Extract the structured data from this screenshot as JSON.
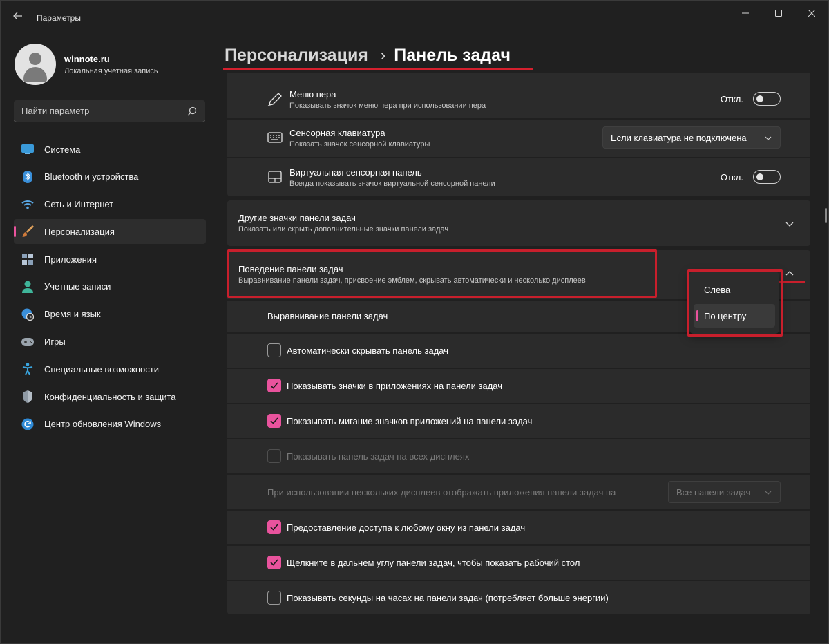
{
  "window": {
    "title": "Параметры",
    "back_icon": "arrow-left-icon",
    "controls": [
      "minimize-icon",
      "maximize-icon",
      "close-icon"
    ]
  },
  "profile": {
    "name": "winnote.ru",
    "account_type": "Локальная учетная запись"
  },
  "search": {
    "placeholder": "Найти параметр"
  },
  "sidebar": {
    "items": [
      {
        "label": "Система",
        "icon": "monitor-icon"
      },
      {
        "label": "Bluetooth и устройства",
        "icon": "bluetooth-icon"
      },
      {
        "label": "Сеть и Интернет",
        "icon": "wifi-icon"
      },
      {
        "label": "Персонализация",
        "icon": "brush-icon",
        "active": true
      },
      {
        "label": "Приложения",
        "icon": "apps-icon"
      },
      {
        "label": "Учетные записи",
        "icon": "person-icon"
      },
      {
        "label": "Время и язык",
        "icon": "globe-clock-icon"
      },
      {
        "label": "Игры",
        "icon": "gamepad-icon"
      },
      {
        "label": "Специальные возможности",
        "icon": "accessibility-icon"
      },
      {
        "label": "Конфиденциальность и защита",
        "icon": "shield-icon"
      },
      {
        "label": "Центр обновления Windows",
        "icon": "update-icon"
      }
    ],
    "accent_color": "#e9539d"
  },
  "breadcrumb": {
    "parent": "Персонализация",
    "separator": "›",
    "current": "Панель задач"
  },
  "system_tray_icons": {
    "pen_menu": {
      "title": "Меню пера",
      "subtitle": "Показывать значок меню пера при использовании пера",
      "icon": "pen-icon",
      "toggle_label": "Откл.",
      "toggle_on": false
    },
    "touch_keyboard": {
      "title": "Сенсорная клавиатура",
      "subtitle": "Показать значок сенсорной клавиатуры",
      "icon": "keyboard-icon",
      "select_value": "Если клавиатура не подключена"
    },
    "virtual_touchpad": {
      "title": "Виртуальная сенсорная панель",
      "subtitle": "Всегда показывать значок виртуальной сенсорной панели",
      "icon": "touchpad-icon",
      "toggle_label": "Откл.",
      "toggle_on": false
    }
  },
  "other_icons": {
    "title": "Другие значки панели задач",
    "subtitle": "Показать или скрыть дополнительные значки панели задач"
  },
  "behavior": {
    "title": "Поведение панели задач",
    "subtitle": "Выравнивание панели задач, присвоение эмблем, скрывать автоматически и несколько дисплеев",
    "alignment_label": "Выравнивание панели задач",
    "alignment_options": [
      "Слева",
      "По центру"
    ],
    "alignment_selected": "По центру",
    "options": [
      {
        "label": "Автоматически скрывать панель задач",
        "checked": false,
        "disabled": false
      },
      {
        "label": "Показывать значки в приложениях на панели задач",
        "checked": true,
        "disabled": false
      },
      {
        "label": "Показывать мигание значков приложений на панели задач",
        "checked": true,
        "disabled": false
      },
      {
        "label": "Показывать панель задач на всех дисплеях",
        "checked": false,
        "disabled": true
      }
    ],
    "multi_display": {
      "label": "При использовании нескольких дисплеев отображать приложения панели задач на",
      "select_value": "Все панели задач",
      "disabled": true
    },
    "options2": [
      {
        "label": "Предоставление доступа к любому окну из панели задач",
        "checked": true,
        "disabled": false
      },
      {
        "label": "Щелкните в дальнем углу панели задач, чтобы показать рабочий стол",
        "checked": true,
        "disabled": false
      },
      {
        "label": "Показывать секунды на часах на панели задач (потребляет больше энергии)",
        "checked": false,
        "disabled": false
      }
    ]
  },
  "colors": {
    "background": "#202020",
    "card": "#2b2b2b",
    "accent": "#e9539d",
    "highlight_red": "#c81f2c"
  }
}
